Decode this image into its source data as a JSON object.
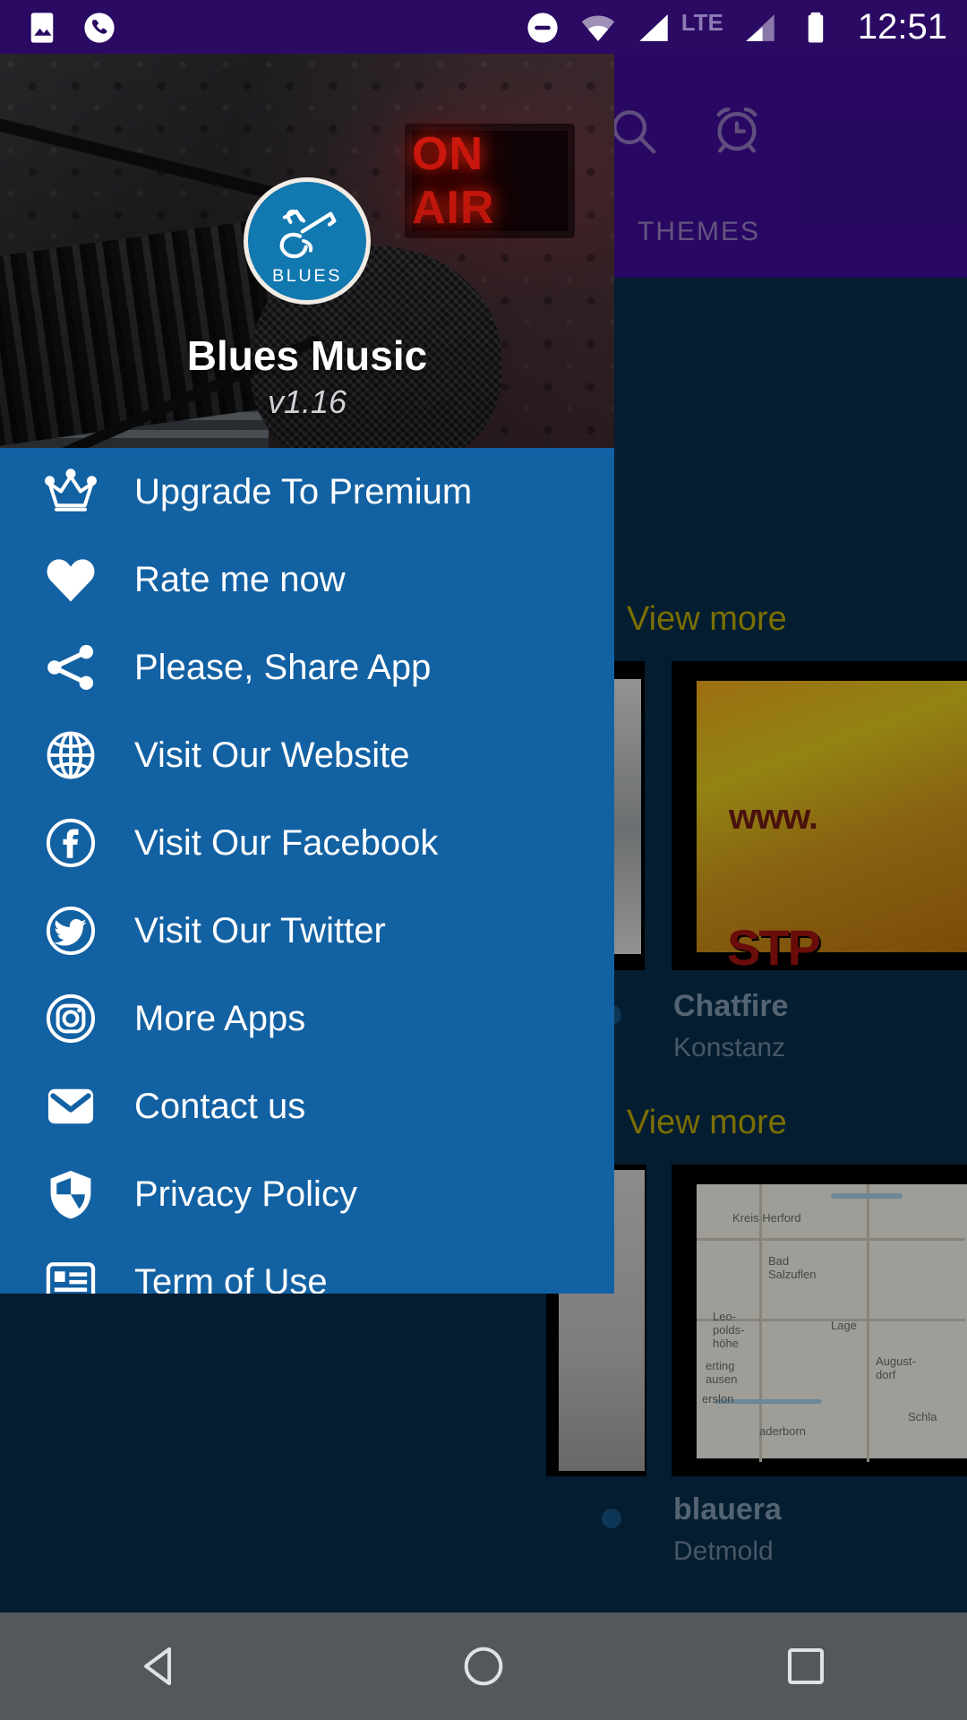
{
  "status_bar": {
    "icons_left": [
      "image-icon",
      "phone-call-icon"
    ],
    "icons_right": [
      "do-not-disturb-icon",
      "wifi-icon",
      "signal-icon",
      "signal-icon-2",
      "battery-icon"
    ],
    "network_label": "LTE",
    "clock": "12:51",
    "background_color": "#2a0a63"
  },
  "background_app": {
    "appbar": {
      "background_color": "#3b0d91",
      "search_icon": "search-icon",
      "alarm_icon": "alarm-clock-icon"
    },
    "tabs": [
      {
        "label": "THEMES"
      }
    ],
    "sections": [
      {
        "view_more_label": "View more"
      },
      {
        "view_more_label": "View more"
      }
    ],
    "cards": [
      {
        "title": "Chatfire",
        "subtitle": "Konstanz"
      },
      {
        "title": "blauera",
        "subtitle": "Detmold"
      }
    ],
    "card_art": {
      "www_text": "www.",
      "stp_text": "STP",
      "map_labels": [
        "Kreis Herford",
        "Bad Salzuflen",
        "Leo-polds-höhe",
        "Lage",
        "August-dorf",
        "erting hausen",
        "erslon",
        "aderborn",
        "Schla"
      ]
    }
  },
  "drawer": {
    "background_color": "#1261a3",
    "app_title": "Blues Music",
    "app_version": "v1.16",
    "logo_text": "BLUES",
    "menu_items": [
      {
        "icon": "crown-icon",
        "label": "Upgrade To Premium"
      },
      {
        "icon": "heart-icon",
        "label": "Rate me now"
      },
      {
        "icon": "share-icon",
        "label": "Please, Share App"
      },
      {
        "icon": "globe-icon",
        "label": "Visit Our Website"
      },
      {
        "icon": "facebook-icon",
        "label": "Visit Our Facebook"
      },
      {
        "icon": "twitter-icon",
        "label": "Visit Our Twitter"
      },
      {
        "icon": "instagram-icon",
        "label": "More Apps"
      },
      {
        "icon": "envelope-icon",
        "label": "Contact us"
      },
      {
        "icon": "shield-icon",
        "label": "Privacy Policy"
      },
      {
        "icon": "list-icon",
        "label": "Term of Use"
      }
    ]
  },
  "nav_bar": {
    "background_color": "#53585c",
    "buttons": [
      {
        "icon": "back-triangle-icon"
      },
      {
        "icon": "home-circle-icon"
      },
      {
        "icon": "recents-square-icon"
      }
    ]
  }
}
